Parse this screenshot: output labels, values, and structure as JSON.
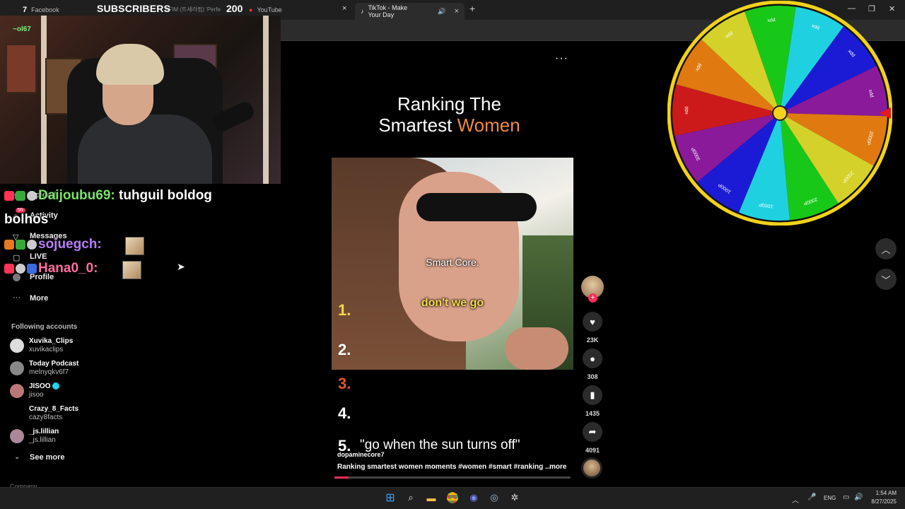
{
  "browser": {
    "tabs": [
      {
        "label": "Facebook"
      },
      {
        "label": "YouTube"
      },
      {
        "label": "TikTok - Make Your Day"
      }
    ],
    "tab_counter": "7",
    "ticker": "AFIM (트세라핌) 'Perfe",
    "new_tab_glyph": "+",
    "close_glyph": "×",
    "window_controls": {
      "minimize": "—",
      "maximize": "❐",
      "close": "✕"
    }
  },
  "overlay": {
    "subscribers_label": "SUBSCRIBERS",
    "subscribers_count": "200",
    "cam_tag": "~ol67"
  },
  "chat": [
    {
      "user": "Daijoubu69:",
      "message": "tuhguil boldog",
      "message_cont": "bolhos",
      "user_color": "#7be36a"
    },
    {
      "user": "sojuegch:",
      "message": "",
      "user_color": "#b77cf5"
    },
    {
      "user": "Hana0_0:",
      "message": "",
      "user_color": "#ff6fa0"
    }
  ],
  "sidebar": {
    "nav": [
      {
        "label": "Upload"
      },
      {
        "label": "Activity",
        "badge": "55"
      },
      {
        "label": "Messages"
      },
      {
        "label": "LIVE"
      },
      {
        "label": "Profile"
      },
      {
        "label": "More"
      }
    ],
    "following_title": "Following accounts",
    "accounts": [
      {
        "name": "Xuvika_Clips",
        "handle": "xuvikaclips"
      },
      {
        "name": "Today Podcast",
        "handle": "melnyqkv6f7"
      },
      {
        "name": "JISOO",
        "handle": "jisoo",
        "verified": true
      },
      {
        "name": "Crazy_8_Facts",
        "handle": "cazy8facts"
      },
      {
        "name": "_js.lillian",
        "handle": "_js.lillian"
      }
    ],
    "see_more": "See more",
    "company": "Company"
  },
  "video": {
    "title_line1": "Ranking The",
    "title_line2_plain": "Smartest ",
    "title_line2_accent": "Women",
    "caption_top": "Smart Core.",
    "caption_bottom": "don't we go",
    "ranks": [
      "1.",
      "2.",
      "3.",
      "4.",
      "5."
    ],
    "rank5_text": "\"go when the sun turns off\"",
    "username": "dopaminecore7",
    "description": "Ranking smartest women moments #women  #smart  #ranking  ...",
    "more": "more",
    "more_menu": "···",
    "progress": 0.06,
    "accent_color": "#f08a3c",
    "rank3_color": "#e0582a"
  },
  "rail": {
    "likes": "23K",
    "comments": "308",
    "saves": "1435",
    "shares": "4091"
  },
  "wheel": {
    "labels": [
      "xdd",
      "xdd",
      "xdd",
      "2000P",
      "2000P",
      "2000P",
      "1000P",
      "1000P",
      "3000P",
      "xdd",
      "xdd",
      "xdd",
      "xdd"
    ],
    "colors": [
      "#1fd1e0",
      "#1b1bd6",
      "#8a1a9a",
      "#e07a10",
      "#d4d12a",
      "#18c818",
      "#1fd1e0",
      "#1b1bd6",
      "#8a1a9a",
      "#cc1a1a",
      "#e07a10",
      "#d4d12a",
      "#18c818"
    ],
    "pointer_color": "#e21a1a"
  },
  "taskbar": {
    "time": "1:54 AM",
    "date": "8/27/2025",
    "lang": "ENG"
  }
}
